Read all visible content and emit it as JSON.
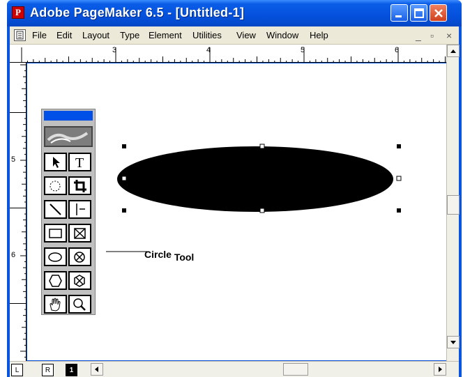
{
  "window": {
    "title": "Adobe PageMaker 6.5 - [Untitled-1]",
    "app_icon_letter": "P"
  },
  "menubar": {
    "items": [
      "File",
      "Edit",
      "Layout",
      "Type",
      "Element",
      "Utilities",
      "View",
      "Window",
      "Help"
    ],
    "mdi_min": "_",
    "mdi_restore": "▫",
    "mdi_close": "×"
  },
  "rulers": {
    "horizontal_labels": [
      "3",
      "4",
      "5",
      "6"
    ],
    "vertical_labels": [
      "5",
      "6"
    ]
  },
  "pages": {
    "left_master": "L",
    "right_master": "R",
    "current_page": "1"
  },
  "callout": {
    "part1": "Circle",
    "part2": "Tool"
  },
  "icons": {
    "toolbox": [
      "arrow-pointer-icon",
      "text-tool-icon",
      "rotate-icon",
      "crop-icon",
      "line-icon",
      "constrained-line-icon",
      "rectangle-icon",
      "rectangle-frame-icon",
      "ellipse-icon",
      "ellipse-frame-icon",
      "polygon-icon",
      "polygon-frame-icon",
      "hand-icon",
      "zoom-icon"
    ]
  },
  "colors": {
    "titlebar": "#0a55e0",
    "toolbox_title": "#0050e8",
    "ellipse_fill": "#000000"
  }
}
